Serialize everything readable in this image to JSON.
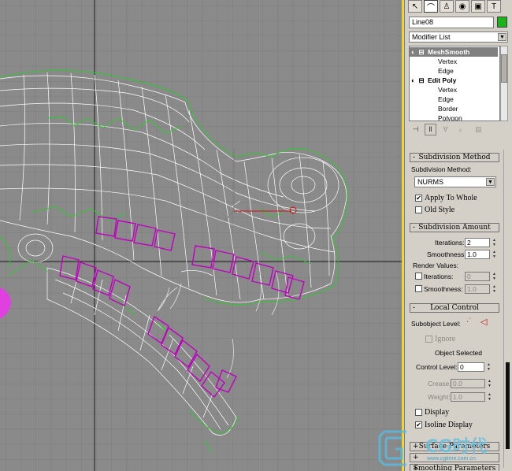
{
  "object_name": "Line08",
  "object_color": "#1cb21c",
  "modifier_list_label": "Modifier List",
  "stack": [
    {
      "label": "MeshSmooth",
      "level": 0,
      "selected": true
    },
    {
      "label": "Vertex",
      "level": 1
    },
    {
      "label": "Edge",
      "level": 1
    },
    {
      "label": "Edit Poly",
      "level": 0
    },
    {
      "label": "Vertex",
      "level": 1
    },
    {
      "label": "Edge",
      "level": 1
    },
    {
      "label": "Border",
      "level": 1
    },
    {
      "label": "Polygon",
      "level": 1
    }
  ],
  "rollouts": {
    "subdivision_method": {
      "title": "Subdivision Method",
      "method_label": "Subdivision Method:",
      "method_value": "NURMS",
      "apply_to_whole": "Apply To Whole",
      "apply_to_whole_checked": "✔",
      "old_style": "Old Style"
    },
    "subdivision_amount": {
      "title": "Subdivision Amount",
      "iterations_label": "Iterations:",
      "iterations_value": "2",
      "smoothness_label": "Smoothness:",
      "smoothness_value": "1.0",
      "render_values_label": "Render Values:",
      "render_iterations_label": "Iterations:",
      "render_iterations_value": "0",
      "render_smoothness_label": "Smoothness:",
      "render_smoothness_value": "1.0"
    },
    "local_control": {
      "title": "Local Control",
      "subobject_level_label": "Subobject Level:",
      "ignore_label": "Ignore",
      "object_selected": "Object Selected",
      "control_level_label": "Control Level:",
      "control_level_value": "0",
      "crease_label": "Crease:",
      "crease_value": "0.0",
      "weight_label": "Weight:",
      "weight_value": "1.0",
      "display_label": "Display",
      "isoline_label": "Isoline Display",
      "isoline_checked": "✔"
    },
    "surface_params": {
      "title": "Surface Parameters"
    },
    "smoothing_params": {
      "title": "Smoothing Parameters"
    }
  },
  "watermark": {
    "text": "CG时代",
    "url": "www.cgtime.com.cn"
  }
}
